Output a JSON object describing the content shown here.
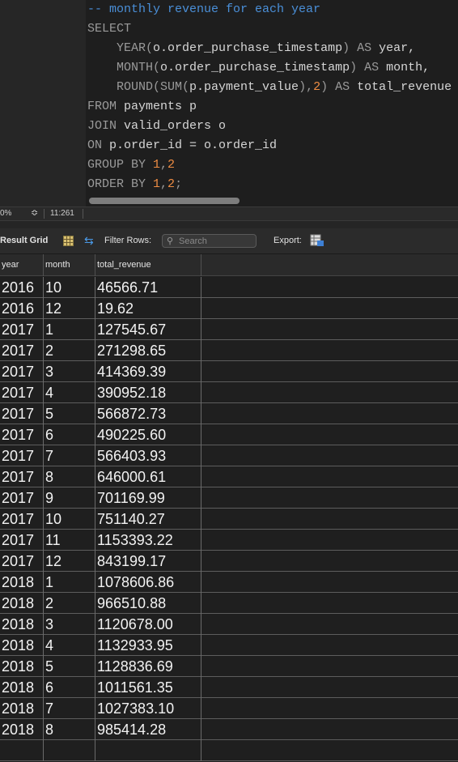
{
  "editor": {
    "lines": [
      [
        {
          "t": "-- monthly revenue for each year",
          "c": "cm"
        }
      ],
      [
        {
          "t": "SELECT",
          "c": "kw"
        }
      ],
      [
        {
          "t": "    ",
          "c": "id"
        },
        {
          "t": "YEAR(",
          "c": "kw"
        },
        {
          "t": "o.order_purchase_timestamp",
          "c": "id"
        },
        {
          "t": ") AS ",
          "c": "kw"
        },
        {
          "t": "year,",
          "c": "id"
        }
      ],
      [
        {
          "t": "    ",
          "c": "id"
        },
        {
          "t": "MONTH(",
          "c": "kw"
        },
        {
          "t": "o.order_purchase_timestamp",
          "c": "id"
        },
        {
          "t": ") AS ",
          "c": "kw"
        },
        {
          "t": "month,",
          "c": "id"
        }
      ],
      [
        {
          "t": "    ",
          "c": "id"
        },
        {
          "t": "ROUND(SUM(",
          "c": "kw"
        },
        {
          "t": "p.payment_value",
          "c": "id"
        },
        {
          "t": "),",
          "c": "kw"
        },
        {
          "t": "2",
          "c": "nm"
        },
        {
          "t": ") AS ",
          "c": "kw"
        },
        {
          "t": "total_revenue",
          "c": "id"
        }
      ],
      [
        {
          "t": "FROM ",
          "c": "kw"
        },
        {
          "t": "payments p",
          "c": "id"
        }
      ],
      [
        {
          "t": "JOIN ",
          "c": "kw"
        },
        {
          "t": "valid_orders o",
          "c": "id"
        }
      ],
      [
        {
          "t": "ON ",
          "c": "kw"
        },
        {
          "t": "p.order_id = o.order_id",
          "c": "id"
        }
      ],
      [
        {
          "t": "GROUP BY ",
          "c": "kw"
        },
        {
          "t": "1",
          "c": "nm"
        },
        {
          "t": ",",
          "c": "kw"
        },
        {
          "t": "2",
          "c": "nm"
        }
      ],
      [
        {
          "t": "ORDER BY ",
          "c": "kw"
        },
        {
          "t": "1",
          "c": "nm"
        },
        {
          "t": ",",
          "c": "kw"
        },
        {
          "t": "2",
          "c": "nm"
        },
        {
          "t": ";",
          "c": "kw"
        }
      ]
    ]
  },
  "statusbar": {
    "zoom": "0%",
    "zoom_stepper": "≎",
    "cursor_position": "11:261"
  },
  "toolbar": {
    "result_grid_label": "Result Grid",
    "filter_label": "Filter Rows:",
    "search_placeholder": "Search",
    "export_label": "Export:",
    "icons": {
      "grid": "grid-layout-icon",
      "refresh": "refresh-arrows-icon",
      "search": "magnifier-icon",
      "export": "export-spreadsheet-icon"
    }
  },
  "grid": {
    "columns": [
      "year",
      "month",
      "total_revenue"
    ],
    "rows": [
      [
        "2016",
        "10",
        "46566.71"
      ],
      [
        "2016",
        "12",
        "19.62"
      ],
      [
        "2017",
        "1",
        "127545.67"
      ],
      [
        "2017",
        "2",
        "271298.65"
      ],
      [
        "2017",
        "3",
        "414369.39"
      ],
      [
        "2017",
        "4",
        "390952.18"
      ],
      [
        "2017",
        "5",
        "566872.73"
      ],
      [
        "2017",
        "6",
        "490225.60"
      ],
      [
        "2017",
        "7",
        "566403.93"
      ],
      [
        "2017",
        "8",
        "646000.61"
      ],
      [
        "2017",
        "9",
        "701169.99"
      ],
      [
        "2017",
        "10",
        "751140.27"
      ],
      [
        "2017",
        "11",
        "1153393.22"
      ],
      [
        "2017",
        "12",
        "843199.17"
      ],
      [
        "2018",
        "1",
        "1078606.86"
      ],
      [
        "2018",
        "2",
        "966510.88"
      ],
      [
        "2018",
        "3",
        "1120678.00"
      ],
      [
        "2018",
        "4",
        "1132933.95"
      ],
      [
        "2018",
        "5",
        "1128836.69"
      ],
      [
        "2018",
        "6",
        "1011561.35"
      ],
      [
        "2018",
        "7",
        "1027383.10"
      ],
      [
        "2018",
        "8",
        "985414.28"
      ]
    ]
  },
  "colors": {
    "comment": "#4a8fd8",
    "keyword": "#9a9a9a",
    "number": "#ee8c43",
    "identifier": "#d6d6d6",
    "refresh_icon": "#4a9ae8"
  }
}
